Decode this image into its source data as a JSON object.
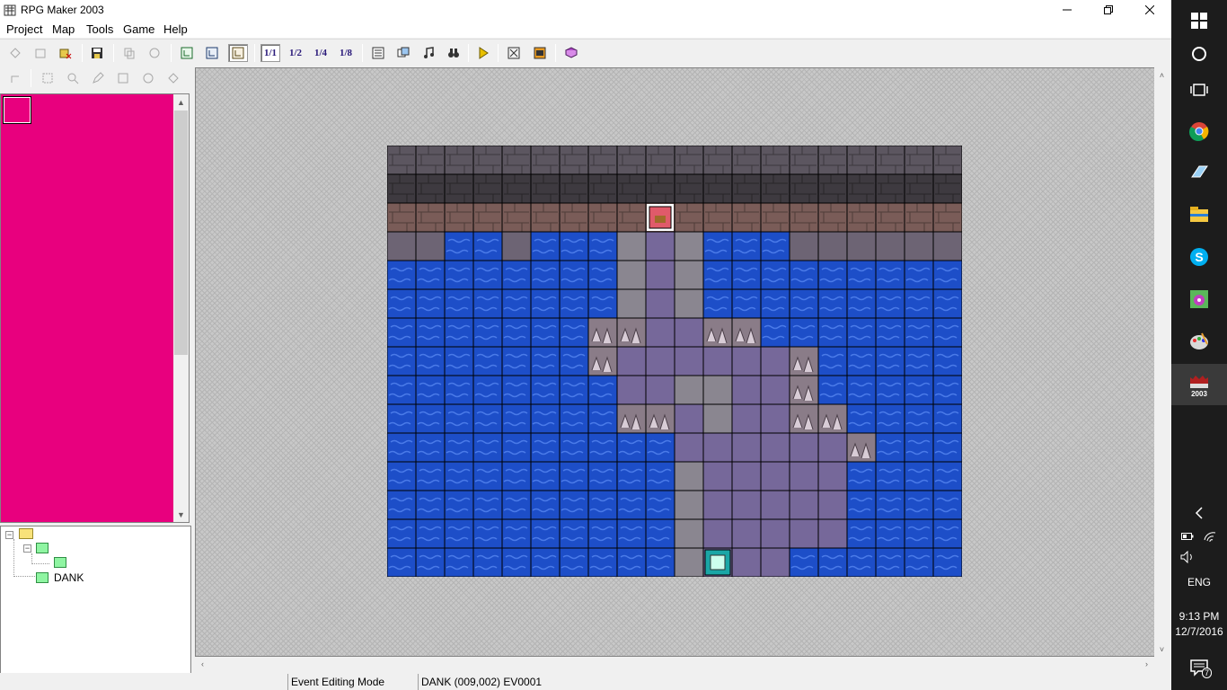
{
  "window": {
    "title": "RPG Maker 2003",
    "minimize_icon": "minimize-icon",
    "maximize_icon": "maximize-icon",
    "close_icon": "close-icon"
  },
  "menu": [
    {
      "label": "Project"
    },
    {
      "label": "Map"
    },
    {
      "label": "Tools"
    },
    {
      "label": "Game"
    },
    {
      "label": "Help"
    }
  ],
  "toolbar": {
    "zoom_labels": [
      "1/1",
      "1/2",
      "1/4",
      "1/8"
    ]
  },
  "tree": {
    "map_name": "DANK"
  },
  "status": {
    "mode": "Event Editing Mode",
    "location": "DANK (009,002) EV0001"
  },
  "taskbar": {
    "language": "ENG",
    "time": "9:13 PM",
    "date": "12/7/2016",
    "notification_count": "7",
    "app_label": "2003"
  },
  "colors": {
    "palette_bg": "#e8007e",
    "water": "#1d4ec8",
    "cave_wall": "#5a5258",
    "stone_path": "#7a6a94",
    "taskbar": "#1c1c1c"
  }
}
